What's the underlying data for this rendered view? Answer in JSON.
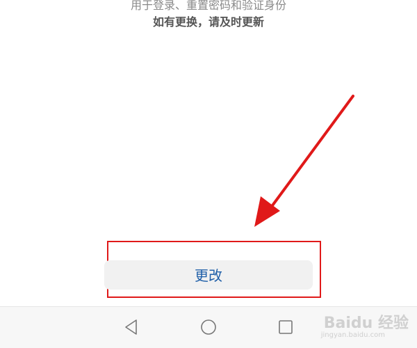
{
  "info": {
    "line1": "用于登录、重置密码和验证身份",
    "line2": "如有更换，请及时更新"
  },
  "action": {
    "change_label": "更改"
  },
  "nav": {
    "back_icon": "triangle-back-icon",
    "home_icon": "circle-home-icon",
    "recent_icon": "square-recent-icon"
  },
  "watermark": {
    "brand": "Baidu 经验",
    "url": "jingyan.baidu.com"
  },
  "colors": {
    "annotation_red": "#e01919",
    "button_text": "#1f5fa8",
    "button_bg": "#f1f1f1"
  }
}
